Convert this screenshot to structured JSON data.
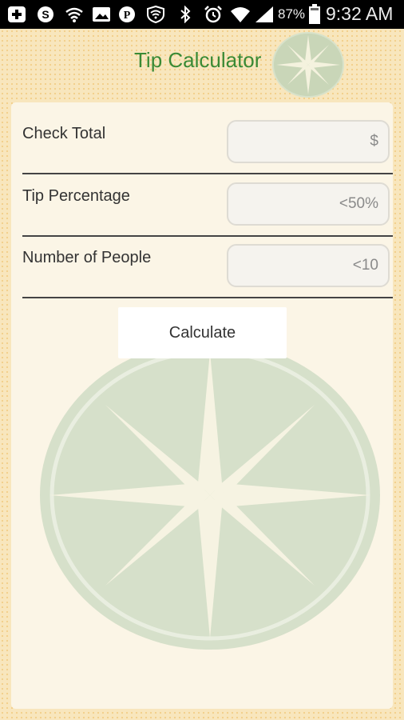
{
  "status_bar": {
    "battery_percent": "87%",
    "time": "9:32 AM",
    "icons": [
      "plus-icon",
      "skype-icon",
      "wifi-icon",
      "image-icon",
      "pinterest-icon",
      "wifi-shield-icon",
      "bluetooth-icon",
      "alarm-icon",
      "wifi-full-icon",
      "signal-icon",
      "battery-icon"
    ]
  },
  "header": {
    "title": "Tip Calculator"
  },
  "form": {
    "check_total": {
      "label": "Check Total",
      "placeholder": "$"
    },
    "tip_percentage": {
      "label": "Tip Percentage",
      "placeholder": "<50%"
    },
    "number_of_people": {
      "label": "Number of People",
      "placeholder": "<10"
    },
    "calculate_label": "Calculate"
  },
  "colors": {
    "title": "#3a8a35",
    "background": "#f8e6bd",
    "compass": "#c9d6b8"
  }
}
